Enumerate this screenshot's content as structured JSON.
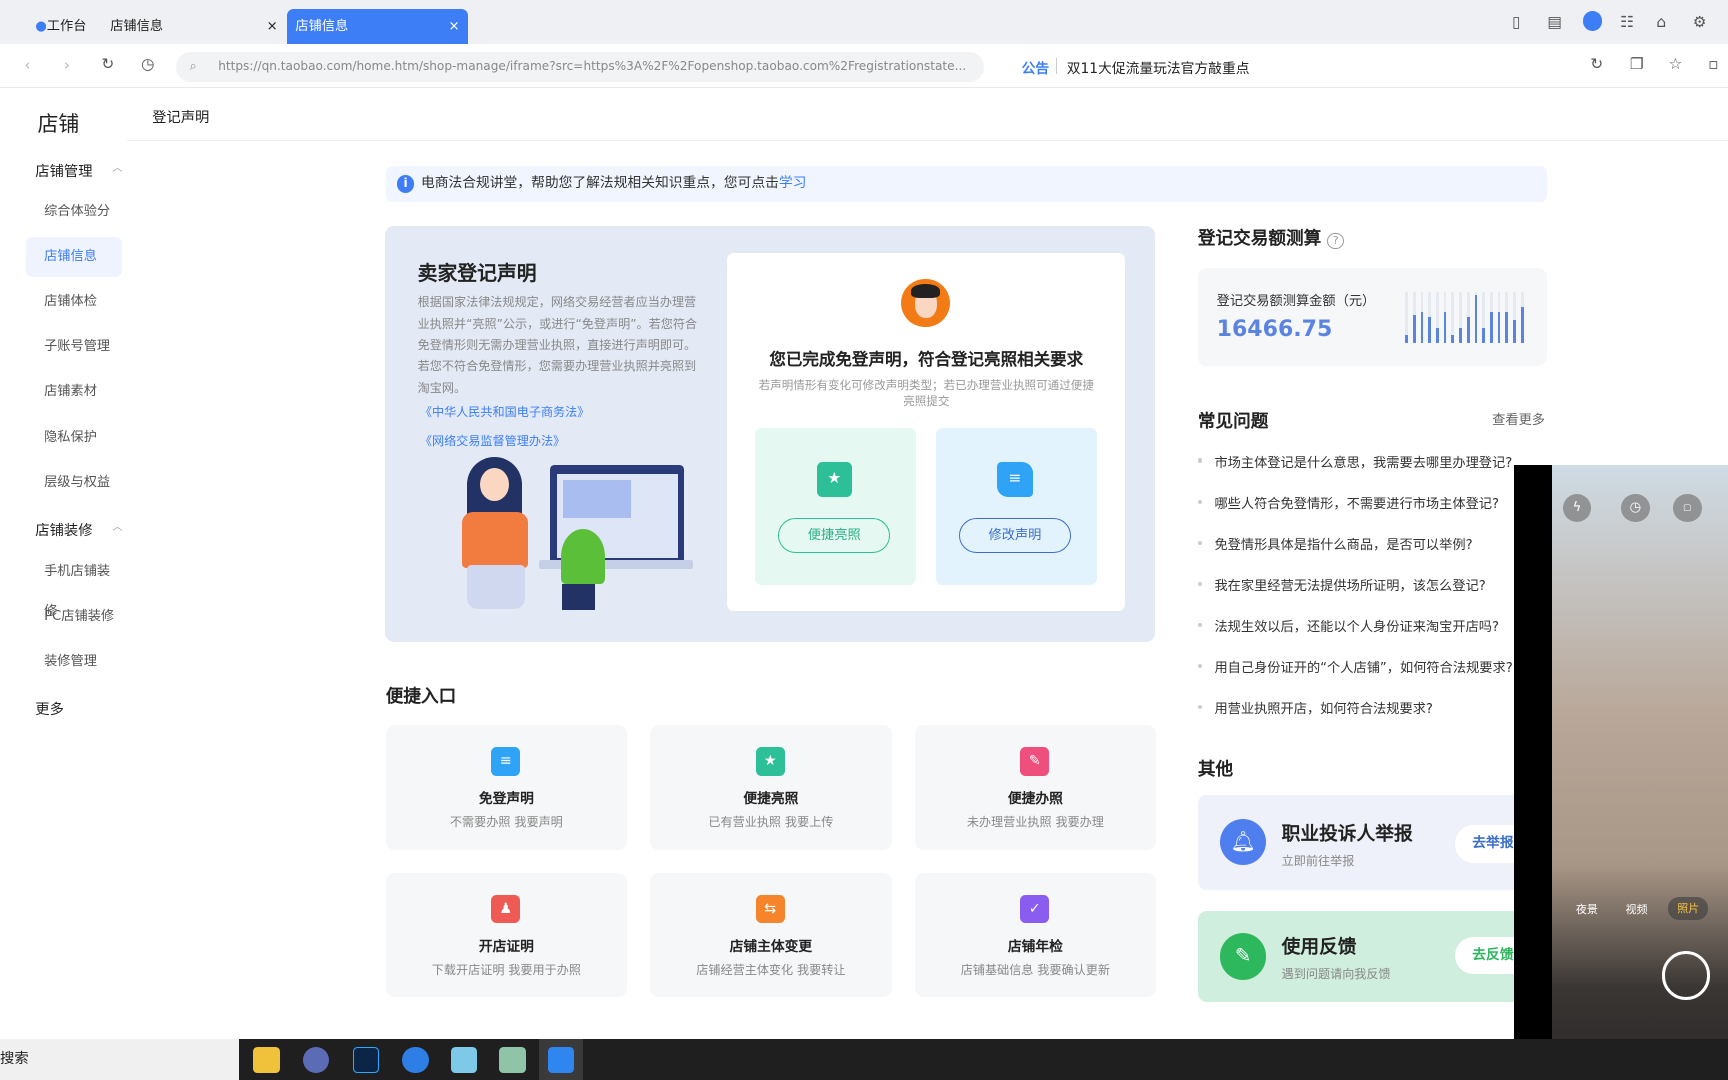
{
  "browser": {
    "tabs": [
      {
        "label": "工作台"
      },
      {
        "label": "店铺信息"
      },
      {
        "label": "店铺信息",
        "active": true
      }
    ],
    "close": "×",
    "url": "https://qn.taobao.com/home.htm/shop-manage/iframe?src=https%3A%2F%2Fopenshop.taobao.com%2Fregistrationstate...",
    "announce_label": "公告",
    "announce_text": "双11大促流量玩法官方敲重点"
  },
  "sidebar": {
    "title": "店铺",
    "groups": [
      {
        "label": "店铺管理",
        "items": [
          "综合体验分",
          "店铺信息",
          "店铺体检",
          "子账号管理",
          "店铺素材",
          "隐私保护",
          "层级与权益"
        ]
      },
      {
        "label": "店铺装修",
        "items": [
          "手机店铺装修",
          "PC店铺装修",
          "装修管理"
        ]
      }
    ],
    "more": "更多",
    "active": "店铺信息"
  },
  "page": {
    "title": "登记声明"
  },
  "notice": {
    "text": "电商法合规讲堂，帮助您了解法规相关知识重点，您可点击",
    "link": "学习"
  },
  "hero": {
    "title": "卖家登记声明",
    "desc": "根据国家法律法规规定，网络交易经营者应当办理营业执照并“亮照”公示，或进行“免登声明”。若您符合免登情形则无需办理营业执照，直接进行声明即可。若您不符合免登情形，您需要办理营业执照并亮照到淘宝网。",
    "laws": [
      "《中华人民共和国电子商务法》",
      "《网络交易监督管理办法》"
    ],
    "status_title": "您已完成免登声明，符合登记亮照相关要求",
    "status_sub": "若声明情形有变化可修改声明类型；若已办理营业执照可通过便捷亮照提交",
    "btn_license": "便捷亮照",
    "btn_modify": "修改声明"
  },
  "quick": {
    "title": "便捷入口",
    "items": [
      {
        "title": "免登声明",
        "sub": "不需要办照 我要声明",
        "color": "#2fa3f5"
      },
      {
        "title": "便捷亮照",
        "sub": "已有营业执照 我要上传",
        "color": "#2cbf98"
      },
      {
        "title": "便捷办照",
        "sub": "未办理营业执照 我要办理",
        "color": "#ef4f7d"
      },
      {
        "title": "开店证明",
        "sub": "下载开店证明 我要用于办照",
        "color": "#f05a55"
      },
      {
        "title": "店铺主体变更",
        "sub": "店铺经营主体变化 我要转让",
        "color": "#f5842b"
      },
      {
        "title": "店铺年检",
        "sub": "店铺基础信息 我要确认更新",
        "color": "#8a5cf0"
      }
    ]
  },
  "calc": {
    "title": "登记交易额测算",
    "help": "?",
    "label": "登记交易额测算金额（元）",
    "value": "16466.75",
    "bars": [
      0.15,
      0.55,
      0.6,
      0.5,
      0.3,
      0.6,
      0.15,
      0.3,
      0.5,
      0.95,
      0.3,
      0.6,
      0.6,
      0.6,
      0.45,
      0.7
    ]
  },
  "faq": {
    "title": "常见问题",
    "more": "查看更多",
    "items": [
      "市场主体登记是什么意思，我需要去哪里办理登记?",
      "哪些人符合免登情形，不需要进行市场主体登记?",
      "免登情形具体是指什么商品，是否可以举例?",
      "我在家里经营无法提供场所证明，该怎么登记?",
      "法规生效以后，还能以个人身份证来淘宝开店吗?",
      "用自己身份证开的“个人店铺”，如何符合法规要求?",
      "用营业执照开店，如何符合法规要求?"
    ]
  },
  "other": {
    "title": "其他",
    "report": {
      "title": "职业投诉人举报",
      "sub": "立即前往举报",
      "btn": "去举报"
    },
    "feedback": {
      "title": "使用反馈",
      "sub": "遇到问题请向我反馈",
      "btn": "去反馈"
    }
  },
  "camera": {
    "modes": [
      "夜景",
      "视频",
      "照片"
    ]
  },
  "taskbar": {
    "search": "搜索"
  }
}
